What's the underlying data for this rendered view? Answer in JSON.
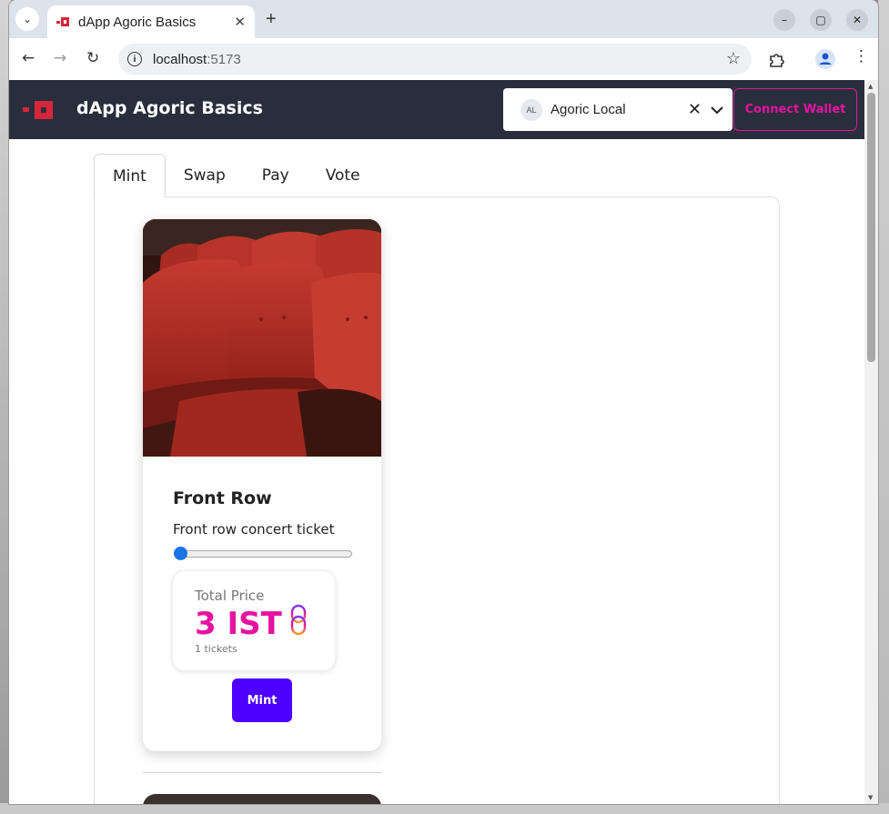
{
  "browser": {
    "tab_title": "dApp Agoric Basics",
    "tab_close": "✕",
    "new_tab": "+",
    "url_host": "localhost",
    "url_port": ":5173",
    "controls": {
      "minimize": "–",
      "maximize": "▢",
      "close": "✕"
    }
  },
  "header": {
    "title": "dApp Agoric Basics",
    "chain_avatar": "AL",
    "chain_name": "Agoric Local",
    "connect_label": "Connect Wallet"
  },
  "tabs": [
    {
      "label": "Mint"
    },
    {
      "label": "Swap"
    },
    {
      "label": "Pay"
    },
    {
      "label": "Vote"
    }
  ],
  "card": {
    "title": "Front Row",
    "description": "Front row concert ticket",
    "slider_value": 1,
    "price_label": "Total Price",
    "price_value": "3 IST",
    "tickets_text": "1 tickets",
    "mint_label": "Mint"
  },
  "colors": {
    "header_bg": "#282e3c",
    "accent_pink": "#e613a0",
    "mint_button": "#4d00ff",
    "logo_red": "#d6253a"
  }
}
